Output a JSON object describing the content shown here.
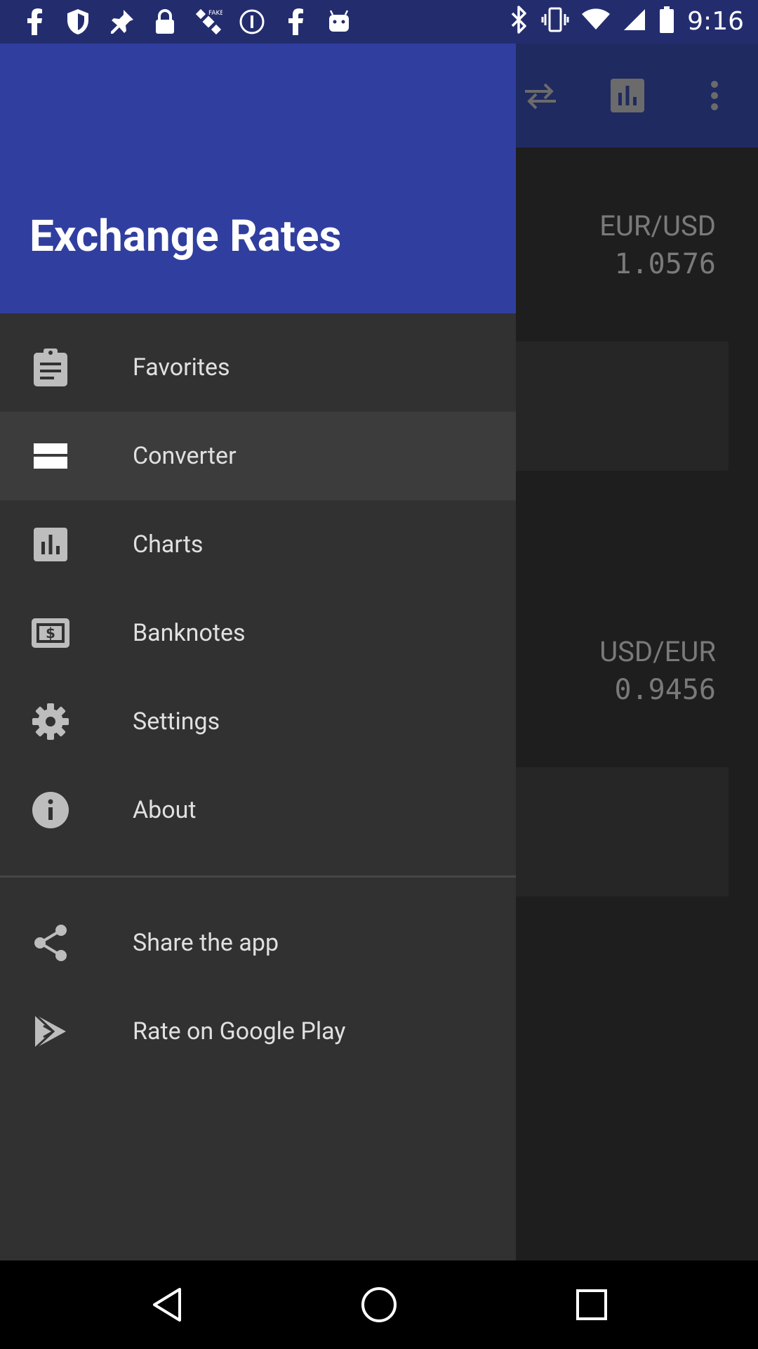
{
  "status_bar": {
    "time": "9:16",
    "left_icons": [
      "facebook-icon",
      "shield-icon",
      "pin-icon",
      "lock-icon",
      "satellite-icon",
      "info-circle-icon",
      "facebook-icon",
      "android-icon"
    ],
    "right_icons": [
      "bluetooth-icon",
      "vibrate-icon",
      "wifi-icon",
      "signal-icon",
      "battery-icon"
    ]
  },
  "app": {
    "rates": [
      {
        "pair": "EUR/USD",
        "value": "1.0576"
      },
      {
        "pair": "USD/EUR",
        "value": "0.9456"
      }
    ]
  },
  "drawer": {
    "title": "Exchange Rates",
    "items": [
      {
        "label": "Favorites",
        "icon": "clipboard-icon"
      },
      {
        "label": "Converter",
        "icon": "converter-icon",
        "active": true
      },
      {
        "label": "Charts",
        "icon": "bar-chart-icon"
      },
      {
        "label": "Banknotes",
        "icon": "banknote-icon"
      },
      {
        "label": "Settings",
        "icon": "gear-icon"
      },
      {
        "label": "About",
        "icon": "info-icon"
      }
    ],
    "secondary_items": [
      {
        "label": "Share the app",
        "icon": "share-icon"
      },
      {
        "label": "Rate on Google Play",
        "icon": "play-store-icon"
      }
    ]
  },
  "colors": {
    "header": "#303f9f",
    "status_bar": "#232d6e",
    "drawer_bg": "#313131",
    "active_row": "#3c3c3c"
  }
}
